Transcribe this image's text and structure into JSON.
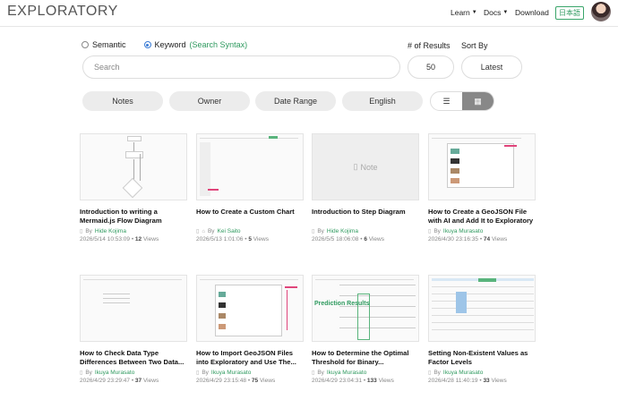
{
  "header": {
    "logo": "EXPLORATORY",
    "nav": [
      {
        "label": "Learn",
        "dropdown": true
      },
      {
        "label": "Docs",
        "dropdown": true
      },
      {
        "label": "Download",
        "dropdown": false
      }
    ],
    "lang_button": "日本語"
  },
  "search": {
    "mode_semantic": "Semantic",
    "mode_keyword": "Keyword",
    "syntax_link": "(Search Syntax)",
    "selected_mode": "keyword",
    "placeholder": "Search",
    "results_label": "# of Results",
    "results_value": "50",
    "sort_label": "Sort By",
    "sort_value": "Latest"
  },
  "filters": [
    "Notes",
    "Owner",
    "Date Range",
    "English"
  ],
  "view": {
    "active": "grid"
  },
  "colors": {
    "accent": "#2f9a5f",
    "toggle_active": "#888888"
  },
  "cards": [
    {
      "title": "Introduction to writing a Mermaid.js Flow Diagram",
      "author": "Hide Kojima",
      "date": "2026/5/14 10:53:09",
      "views": "12",
      "thumb": "flow"
    },
    {
      "title": "How to Create a Custom Chart",
      "author": "Kei Saito",
      "date": "2026/5/13 1:01:06",
      "views": "5",
      "thumb": "table"
    },
    {
      "title": "Introduction to Step Diagram",
      "author": "Hide Kojima",
      "date": "2026/5/5 18:06:08",
      "views": "6",
      "thumb": "note",
      "note_label": "Note"
    },
    {
      "title": "How to Create a GeoJSON File with AI and Add It to Exploratory",
      "author": "Ikuya Murasato",
      "date": "2026/4/30 23:16:35",
      "views": "74",
      "thumb": "list"
    },
    {
      "title": "How to Check Data Type Differences Between Two Data...",
      "author": "Ikuya Murasato",
      "date": "2026/4/29 23:29:47",
      "views": "37",
      "thumb": "blank"
    },
    {
      "title": "How to Import GeoJSON Files into Exploratory and Use The...",
      "author": "Ikuya Murasato",
      "date": "2026/4/29 23:15:48",
      "views": "75",
      "thumb": "list"
    },
    {
      "title": "How to Determine the Optimal Threshold for Binary...",
      "author": "Ikuya Murasato",
      "date": "2026/4/29 23:04:31",
      "views": "133",
      "thumb": "pred",
      "thumb_label": "Prediction Results"
    },
    {
      "title": "Setting Non-Existent Values as Factor Levels",
      "author": "Ikuya Murasato",
      "date": "2026/4/28 11:40:19",
      "views": "33",
      "thumb": "sheet"
    }
  ],
  "labels": {
    "by": "By",
    "views_suffix": "Views"
  }
}
